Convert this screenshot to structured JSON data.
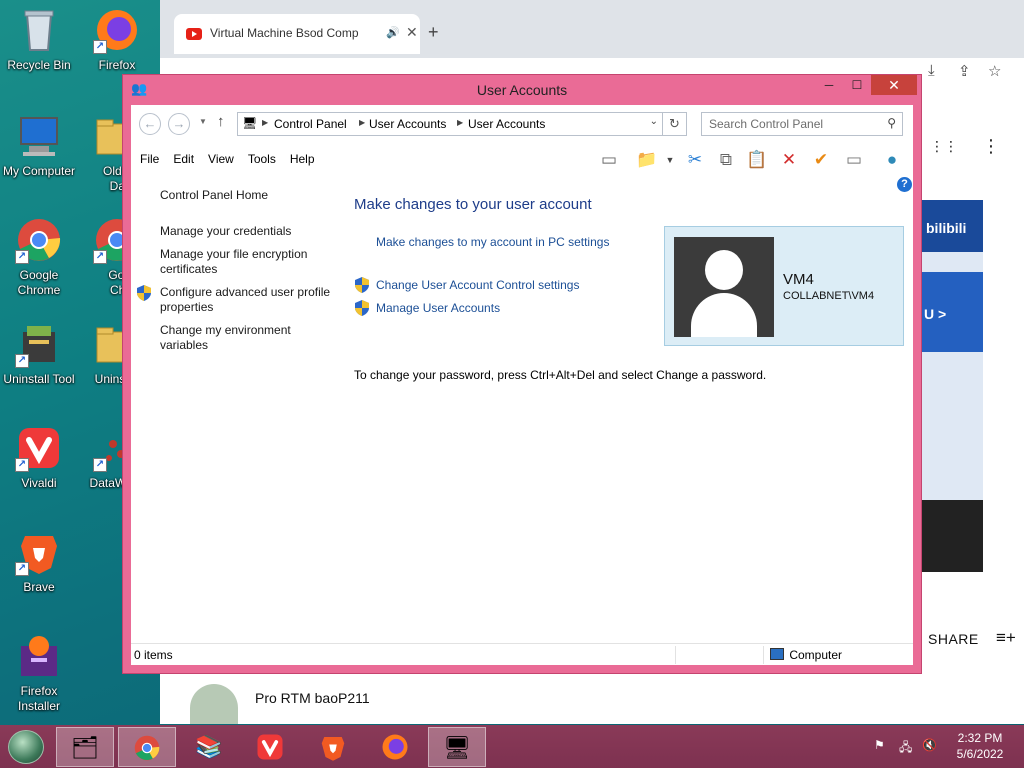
{
  "desktop": {
    "icons": [
      {
        "label": "Recycle Bin"
      },
      {
        "label": "Firefox"
      },
      {
        "label": "My Computer"
      },
      {
        "label": "Old Fi",
        "label_line2": "Dat"
      },
      {
        "label": "Google",
        "label_line2": "Chrome"
      },
      {
        "label": "Goog",
        "label_line2": "Chro"
      },
      {
        "label": "Uninstall Tool"
      },
      {
        "label": "Uninsta"
      },
      {
        "label": "Vivaldi"
      },
      {
        "label": "DataWa"
      },
      {
        "label": "Brave"
      },
      {
        "label": "Firefox",
        "label_line2": "Installer"
      }
    ]
  },
  "browser": {
    "tab_title": "Virtual Machine Bsod Comp",
    "share_label": "SHARE",
    "video_title": "Pro RTM baoP211",
    "bili_logo": "bilibili",
    "bili_banner": "U >"
  },
  "window": {
    "title": "User Accounts",
    "address": {
      "crumbs": [
        "Control Panel",
        "User Accounts",
        "User Accounts"
      ]
    },
    "search": {
      "placeholder": "Search Control Panel"
    },
    "menu": [
      "File",
      "Edit",
      "View",
      "Tools",
      "Help"
    ],
    "left_pane": {
      "home": "Control Panel Home",
      "credentials": "Manage your credentials",
      "encryption": "Manage your file encryption certificates",
      "advanced_profile": "Configure advanced user profile properties",
      "environment": "Change my environment variables"
    },
    "main": {
      "heading": "Make changes to your user account",
      "pc_settings_link": "Make changes to my account in PC settings",
      "uac_link": "Change User Account Control settings",
      "manage_link": "Manage User Accounts",
      "password_note": "To change your password, press Ctrl+Alt+Del and select Change a password."
    },
    "user": {
      "name": "VM4",
      "domain": "COLLABNET\\VM4"
    },
    "status": {
      "items": "0 items",
      "location": "Computer"
    }
  },
  "taskbar": {
    "time": "2:32 PM",
    "date": "5/6/2022"
  },
  "colors": {
    "window_frame": "#ea6b96",
    "close_button": "#c7423c",
    "link": "#1c4f96",
    "heading": "#1e3d8a",
    "taskbar": "#8a3a58",
    "desktop": "#0e7e82"
  }
}
